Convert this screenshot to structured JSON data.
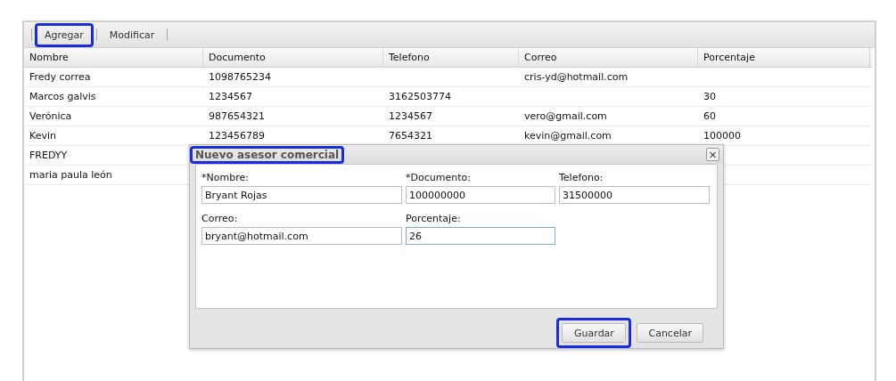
{
  "toolbar": {
    "buttons": [
      {
        "label": "Agregar",
        "highlighted": true
      },
      {
        "label": "Modificar",
        "highlighted": false
      }
    ]
  },
  "table": {
    "columns": [
      "Nombre",
      "Documento",
      "Telefono",
      "Correo",
      "Porcentaje"
    ],
    "rows": [
      [
        "Fredy correa",
        "1098765234",
        "",
        "cris-yd@hotmail.com",
        ""
      ],
      [
        "Marcos galvis",
        "1234567",
        "3162503774",
        "",
        "30"
      ],
      [
        "Verónica",
        "987654321",
        "1234567",
        "vero@gmail.com",
        "60"
      ],
      [
        "Kevin",
        "123456789",
        "7654321",
        "kevin@gmail.com",
        "100000"
      ],
      [
        "FREDYY",
        "",
        "",
        "",
        ""
      ],
      [
        "maria paula león",
        "",
        "",
        "",
        ""
      ]
    ]
  },
  "dialog": {
    "title": "Nuevo asesor comercial",
    "title_highlighted": true,
    "close": "×",
    "fields": [
      {
        "label": "*Nombre:",
        "value": "Bryant Rojas",
        "focused": false
      },
      {
        "label": "*Documento:",
        "value": "100000000",
        "focused": false
      },
      {
        "label": "Telefono:",
        "value": "31500000",
        "focused": false
      },
      {
        "label": "Correo:",
        "value": "bryant@hotmail.com",
        "focused": false
      },
      {
        "label": "Porcentaje:",
        "value": "26",
        "focused": true
      }
    ],
    "buttons": [
      {
        "label": "Guardar",
        "highlighted": true
      },
      {
        "label": "Cancelar",
        "highlighted": false
      }
    ]
  }
}
